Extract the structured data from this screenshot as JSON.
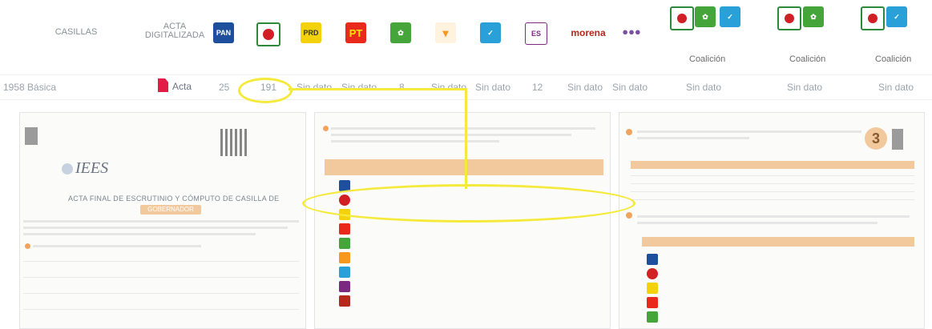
{
  "header": {
    "casilla_label": "CASILLAS",
    "acta_label_line1": "ACTA",
    "acta_label_line2": "DIGITALIZADA",
    "party_logos": [
      {
        "name": "PAN",
        "icon": "pan-logo",
        "color": "#1d4f9c"
      },
      {
        "name": "PRI",
        "icon": "pri-logo",
        "color": "#d11f26"
      },
      {
        "name": "PRD",
        "icon": "prd-logo",
        "color": "#f4d20b"
      },
      {
        "name": "PT",
        "icon": "pt-logo",
        "color": "#e8291c"
      },
      {
        "name": "PVEM",
        "icon": "pvem-logo",
        "color": "#45a53a"
      },
      {
        "name": "MC",
        "icon": "mc-logo",
        "color": "#f7981d"
      },
      {
        "name": "NA",
        "icon": "na-logo",
        "color": "#29a0d8"
      },
      {
        "name": "PES",
        "icon": "pes-logo",
        "color": "#7b2a80"
      },
      {
        "name": "morena",
        "icon": "morena-logo",
        "color": "#b5281c"
      },
      {
        "name": "ES",
        "icon": "es-logo",
        "color": "#7c4fa1"
      }
    ],
    "coalitions": [
      {
        "label": "Coalición",
        "logos": [
          "pri-logo",
          "pvem-logo",
          "na-logo"
        ]
      },
      {
        "label": "Coalición",
        "logos": [
          "pri-logo",
          "pvem-logo"
        ]
      },
      {
        "label": "Coalición",
        "logos": [
          "pri-logo",
          "na-logo"
        ]
      }
    ]
  },
  "row": {
    "casilla": "1958 Básica",
    "acta_button": "Acta",
    "values": [
      "25",
      "191",
      "Sin dato",
      "Sin dato",
      "8",
      "Sin dato",
      "Sin dato",
      "12",
      "Sin dato",
      "Sin dato",
      "Sin dato",
      "Sin dato",
      "Sin dato"
    ]
  },
  "document": {
    "logo_text": "IEES",
    "title_line1": "ACTA FINAL DE ESCRUTINIO Y CÓMPUTO DE CASILLA DE",
    "title_band": "GOBERNADOR",
    "page_number": "3"
  },
  "colors": {
    "highlight": "#f5ea3c",
    "doc_orange": "#f1c99d",
    "accent_red": "#e11d48"
  }
}
